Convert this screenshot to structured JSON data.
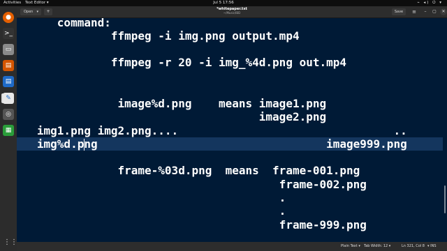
{
  "topbar": {
    "activities": "Activities",
    "app_name": "Text Editor",
    "app_chevron": "▾",
    "clock": "Jul 5  17:56",
    "tray": "⌁ ◂) ⏻ ▾"
  },
  "dock": {
    "icons": [
      {
        "name": "firefox-icon",
        "glyph": "●",
        "color": "#e66000"
      },
      {
        "name": "terminal-icon",
        "glyph": ">_",
        "color": "#333333"
      },
      {
        "name": "files-icon",
        "glyph": "▭",
        "color": "#8a8a8a"
      },
      {
        "name": "document-viewer-icon",
        "glyph": "▤",
        "color": "#d45500"
      },
      {
        "name": "writer-icon",
        "glyph": "▤",
        "color": "#1e6ac8"
      },
      {
        "name": "text-editor-icon",
        "glyph": "✎",
        "color": "#e8e8e8"
      },
      {
        "name": "settings-icon",
        "glyph": "◎",
        "color": "#555555"
      },
      {
        "name": "calc-icon",
        "glyph": "▦",
        "color": "#2a9d3a"
      }
    ],
    "apps_grid": "⋮⋮⋮"
  },
  "header": {
    "open_label": "Open",
    "open_chevron": "▾",
    "new_doc": "+",
    "title": "*whitepaper.txt",
    "subtitle": "~/Music/IBD",
    "save_label": "Save",
    "menu": "≡",
    "minimize": "–",
    "maximize": "▢",
    "close": "✕"
  },
  "editor": {
    "lines": [
      "      command:",
      "              ffmpeg -i img.png output.mp4",
      "",
      "              ffmpeg -r 20 -i img_%4d.png out.mp4",
      "",
      "",
      "               image%d.png    means image1.png",
      "                                    image2.png",
      "   img1.png img2.png....                                ..",
      "   img%d.png                                  image999.png",
      "",
      "               frame-%03d.png  means  frame-001.png",
      "                                       frame-002.png",
      "                                       .",
      "                                       .",
      "                                       frame-999.png"
    ],
    "current_line_index": 9
  },
  "statusbar": {
    "language": "Plain Text ▾",
    "tab_width": "Tab Width: 12 ▾",
    "position": "Ln 321, Col 8",
    "mode": "▾  INS"
  }
}
